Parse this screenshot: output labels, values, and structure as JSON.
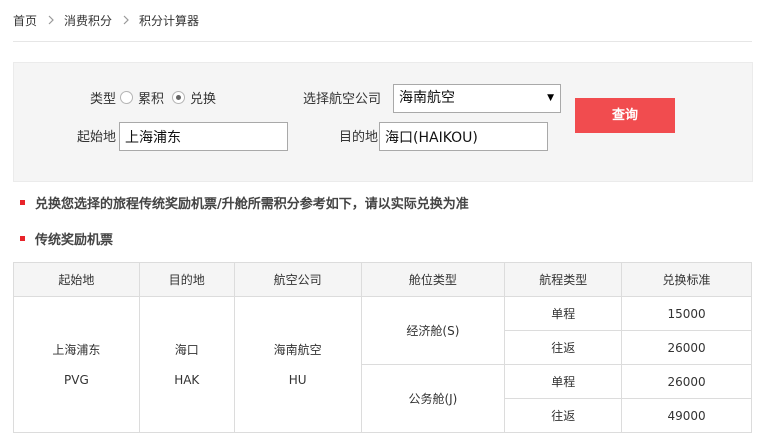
{
  "breadcrumb": {
    "items": [
      "首页",
      "消费积分",
      "积分计算器"
    ],
    "separator_icon": "chevron-right-icon"
  },
  "form": {
    "type_label": "类型",
    "radio_accumulate": "累积",
    "radio_exchange": "兑换",
    "selected_type": "兑换",
    "airline_label": "选择航空公司",
    "airline_value": "海南航空",
    "origin_label": "起始地",
    "origin_value": "上海浦东",
    "destination_label": "目的地",
    "destination_value": "海口(HAIKOU)",
    "query_button": "查询"
  },
  "notes": {
    "exchange_note": "兑换您选择的旅程传统奖励机票/升舱所需积分参考如下，请以实际兑换为准",
    "section_title": "传统奖励机票"
  },
  "table": {
    "headers": [
      "起始地",
      "目的地",
      "航空公司",
      "舱位类型",
      "航程类型",
      "兑换标准"
    ],
    "origin_name": "上海浦东",
    "origin_code": "PVG",
    "destination_name": "海口",
    "destination_code": "HAK",
    "airline_name": "海南航空",
    "airline_code": "HU",
    "cabins": [
      {
        "cabin": "经济舱(S)",
        "trips": [
          {
            "type": "单程",
            "points": "15000"
          },
          {
            "type": "往返",
            "points": "26000"
          }
        ]
      },
      {
        "cabin": "公务舱(J)",
        "trips": [
          {
            "type": "单程",
            "points": "26000"
          },
          {
            "type": "往返",
            "points": "49000"
          }
        ]
      }
    ]
  },
  "colors": {
    "accent_red": "#f14c4f",
    "bullet_red": "#e8242a",
    "panel_bg": "#f5f5f5"
  }
}
